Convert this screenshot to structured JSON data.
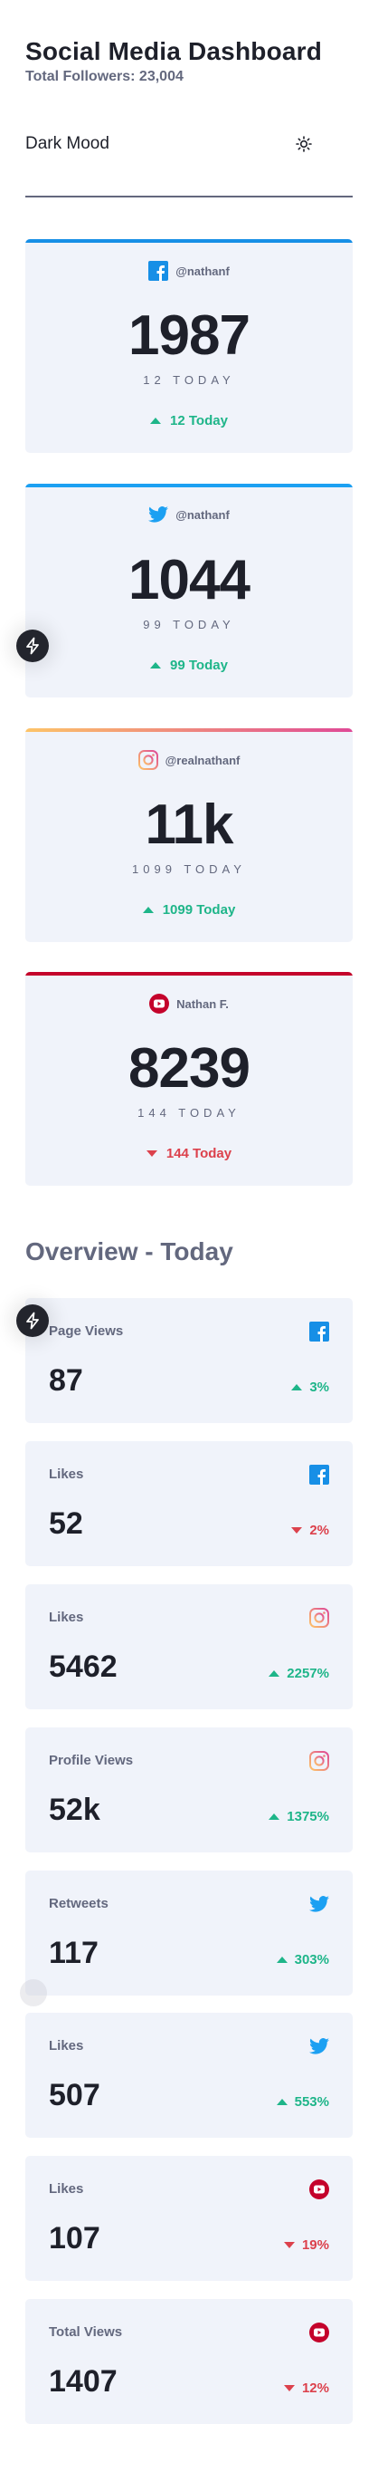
{
  "header": {
    "title": "Social Media Dashboard",
    "total_followers": "Total Followers: 23,004"
  },
  "theme_toggle": {
    "label": "Dark Mood",
    "icon": "sun-icon"
  },
  "colors": {
    "facebook": "#178fe6",
    "twitter": "#1ca0f2",
    "instagram_start": "#fdc468",
    "instagram_end": "#df4996",
    "youtube": "#c4032b",
    "up": "#1eb589",
    "down": "#dc414c"
  },
  "cards": [
    {
      "network": "facebook",
      "icon": "facebook-icon",
      "handle": "@nathanf",
      "count": "1987",
      "followers_label": "12 TODAY",
      "change": "12 Today",
      "trend": "up"
    },
    {
      "network": "twitter",
      "icon": "twitter-icon",
      "handle": "@nathanf",
      "count": "1044",
      "followers_label": "99 TODAY",
      "change": "99 Today",
      "trend": "up"
    },
    {
      "network": "instagram",
      "icon": "instagram-icon",
      "handle": "@realnathanf",
      "count": "11k",
      "followers_label": "1099 TODAY",
      "change": "1099 Today",
      "trend": "up"
    },
    {
      "network": "youtube",
      "icon": "youtube-icon",
      "handle": "Nathan F.",
      "count": "8239",
      "followers_label": "144 TODAY",
      "change": "144 Today",
      "trend": "down"
    }
  ],
  "overview": {
    "title": "Overview - Today",
    "items": [
      {
        "label": "Page Views",
        "icon": "facebook-icon",
        "value": "87",
        "pct": "3%",
        "trend": "up"
      },
      {
        "label": "Likes",
        "icon": "facebook-icon",
        "value": "52",
        "pct": "2%",
        "trend": "down"
      },
      {
        "label": "Likes",
        "icon": "instagram-icon",
        "value": "5462",
        "pct": "2257%",
        "trend": "up"
      },
      {
        "label": "Profile Views",
        "icon": "instagram-icon",
        "value": "52k",
        "pct": "1375%",
        "trend": "up"
      },
      {
        "label": "Retweets",
        "icon": "twitter-icon",
        "value": "117",
        "pct": "303%",
        "trend": "up"
      },
      {
        "label": "Likes",
        "icon": "twitter-icon",
        "value": "507",
        "pct": "553%",
        "trend": "up"
      },
      {
        "label": "Likes",
        "icon": "youtube-icon",
        "value": "107",
        "pct": "19%",
        "trend": "down"
      },
      {
        "label": "Total Views",
        "icon": "youtube-icon",
        "value": "1407",
        "pct": "12%",
        "trend": "down"
      }
    ]
  },
  "floating_buttons": [
    {
      "icon": "lightning-icon"
    },
    {
      "icon": "lightning-icon"
    }
  ]
}
